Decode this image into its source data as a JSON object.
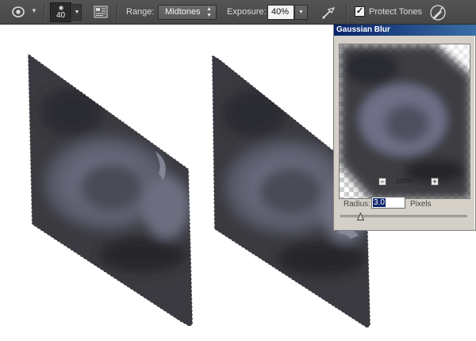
{
  "options_bar": {
    "brush_size": "40",
    "range_label": "Range:",
    "range_value": "Midtones",
    "exposure_label": "Exposure:",
    "exposure_value": "40%",
    "protect_tones_label": "Protect Tones",
    "protect_tones_checked": "✓",
    "icons": [
      "dodge-burn-tool-icon",
      "dropdown-arrow-icon",
      "brush-preset-icon",
      "brush-panel-toggle-icon",
      "airbrush-icon",
      "tablet-pressure-icon"
    ]
  },
  "dialog": {
    "title": "Gaussian Blur",
    "zoom_minus": "−",
    "zoom_level": "100%",
    "zoom_plus": "+",
    "radius_label": "Radius:",
    "radius_value": "3.0",
    "radius_unit": "Pixels",
    "radius_slider_fraction": 0.16
  },
  "colors": {
    "toolbar_bg": "#4d4d4d",
    "dialog_bg": "#d4d0c8",
    "dialog_title": "#0a246a",
    "shape_dark": "#2e2e32",
    "shape_highlight": "#7c7e90"
  }
}
